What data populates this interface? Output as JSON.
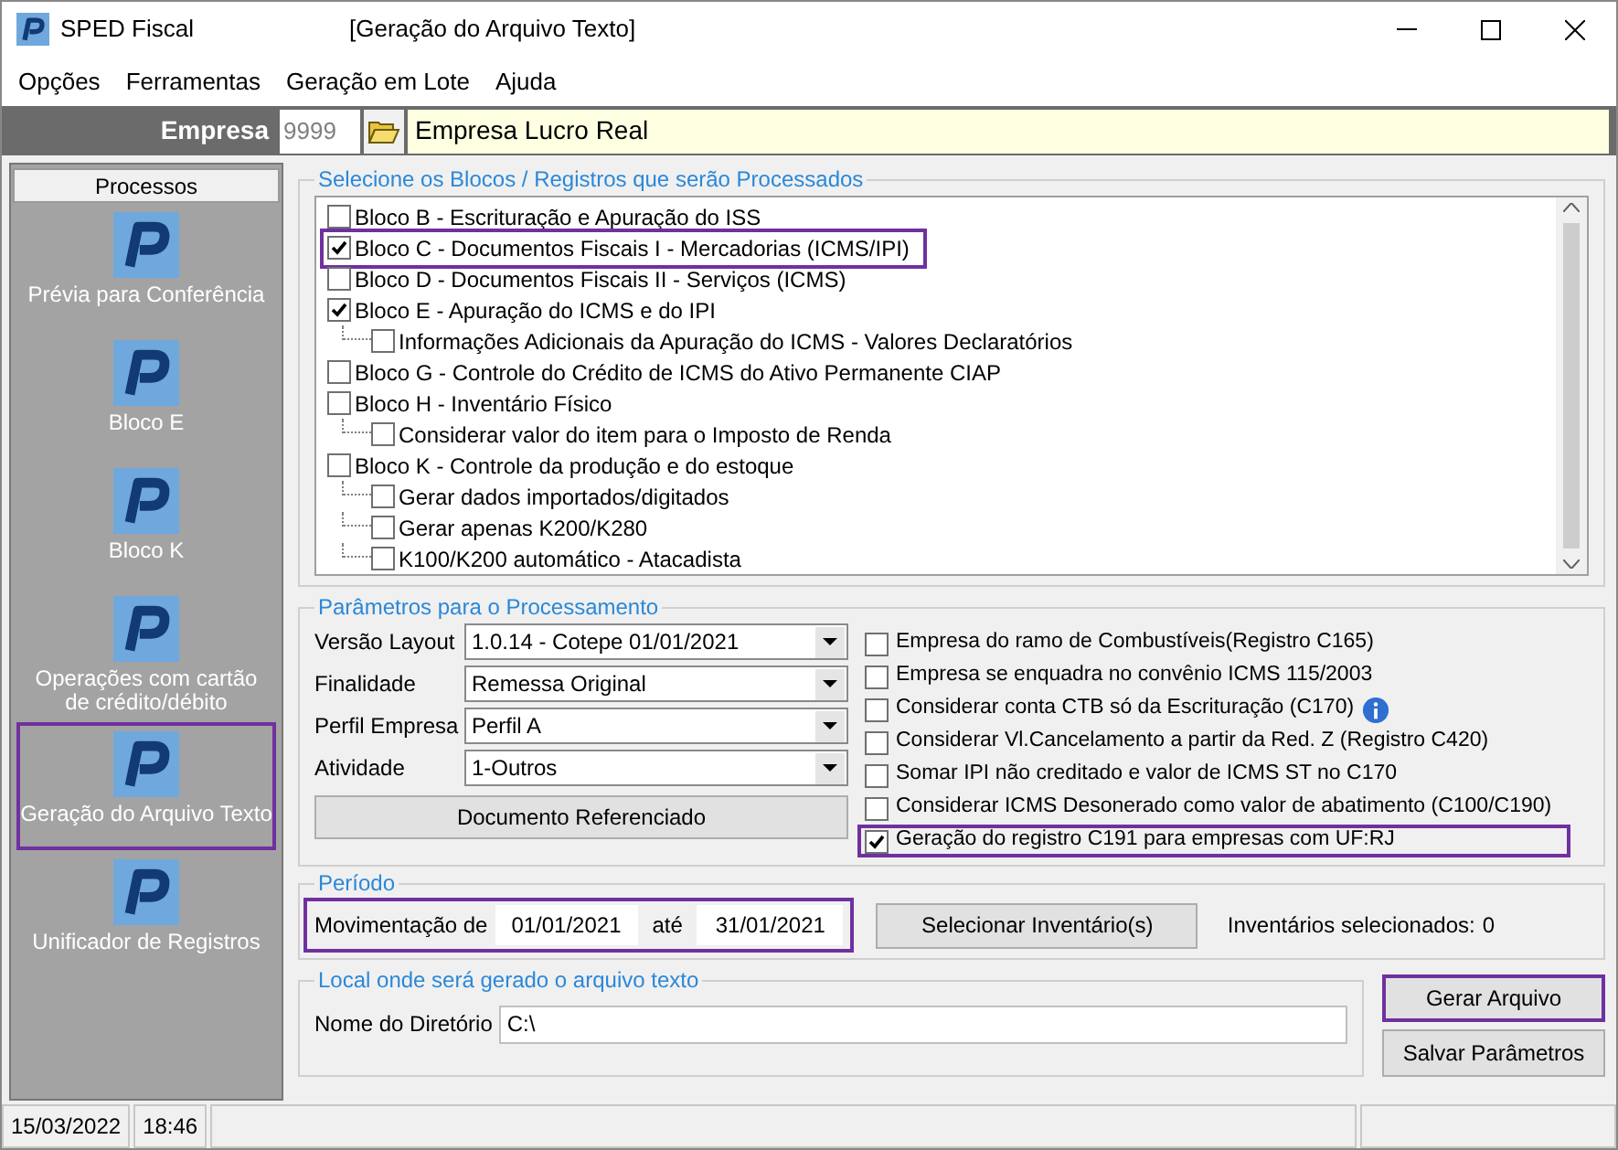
{
  "window": {
    "title": "SPED Fiscal",
    "subtitle": "[Geração do Arquivo Texto]"
  },
  "menu": [
    "Opções",
    "Ferramentas",
    "Geração em Lote",
    "Ajuda"
  ],
  "empresa": {
    "label": "Empresa",
    "code": "9999",
    "name": "Empresa Lucro Real"
  },
  "sidebar": {
    "title": "Processos",
    "items": [
      {
        "label": "Prévia para Conferência",
        "highlighted": false
      },
      {
        "label": "Bloco E",
        "highlighted": false
      },
      {
        "label": "Bloco K",
        "highlighted": false
      },
      {
        "label": "Operações com cartão de crédito/débito",
        "highlighted": false
      },
      {
        "label": "Geração do Arquivo Texto",
        "highlighted": true
      },
      {
        "label": "Unificador de Registros",
        "highlighted": false
      }
    ]
  },
  "blocks": {
    "title": "Selecione os Blocos / Registros que serão Processados",
    "items": [
      {
        "label": "Bloco B - Escrituração e Apuração do ISS",
        "checked": false,
        "highlighted": false
      },
      {
        "label": "Bloco C - Documentos Fiscais I - Mercadorias (ICMS/IPI)",
        "checked": true,
        "highlighted": true
      },
      {
        "label": "Bloco D - Documentos Fiscais II - Serviços (ICMS)",
        "checked": false,
        "highlighted": false
      },
      {
        "label": "Bloco E - Apuração do ICMS e do IPI",
        "checked": true,
        "highlighted": false,
        "children": [
          {
            "label": "Informações Adicionais da Apuração do ICMS - Valores Declaratórios",
            "checked": false,
            "highlighted": false
          }
        ]
      },
      {
        "label": "Bloco G - Controle do Crédito de ICMS do Ativo Permanente CIAP",
        "checked": false,
        "highlighted": false
      },
      {
        "label": "Bloco H - Inventário Físico",
        "checked": false,
        "highlighted": false,
        "children": [
          {
            "label": "Considerar valor do item para o Imposto de Renda",
            "checked": false,
            "highlighted": false
          }
        ]
      },
      {
        "label": "Bloco K - Controle da produção e do estoque",
        "checked": false,
        "highlighted": false,
        "children": [
          {
            "label": "Gerar dados importados/digitados",
            "checked": false,
            "highlighted": false
          },
          {
            "label": "Gerar apenas K200/K280",
            "checked": false,
            "highlighted": false
          },
          {
            "label": "K100/K200 automático - Atacadista",
            "checked": false,
            "highlighted": false
          }
        ]
      }
    ]
  },
  "parameters": {
    "title": "Parâmetros para o Processamento",
    "fields": [
      {
        "label": "Versão Layout",
        "value": "1.0.14 - Cotepe 01/01/2021"
      },
      {
        "label": "Finalidade",
        "value": "Remessa Original"
      },
      {
        "label": "Perfil Empresa",
        "value": "Perfil A"
      },
      {
        "label": "Atividade",
        "value": "1-Outros"
      }
    ],
    "button": "Documento Referenciado",
    "options": [
      {
        "label": "Empresa do ramo de Combustíveis(Registro C165)",
        "checked": false,
        "highlighted": false,
        "info": false
      },
      {
        "label": "Empresa se enquadra no convênio ICMS 115/2003",
        "checked": false,
        "highlighted": false,
        "info": false
      },
      {
        "label": "Considerar conta CTB só da Escrituração (C170)",
        "checked": false,
        "highlighted": false,
        "info": true
      },
      {
        "label": "Considerar Vl.Cancelamento a partir da Red. Z (Registro C420)",
        "checked": false,
        "highlighted": false,
        "info": false
      },
      {
        "label": "Somar IPI não creditado e valor de ICMS ST no C170",
        "checked": false,
        "highlighted": false,
        "info": false
      },
      {
        "label": "Considerar ICMS Desonerado como valor de abatimento (C100/C190)",
        "checked": false,
        "highlighted": false,
        "info": false
      },
      {
        "label": "Geração do registro C191 para empresas com UF:RJ",
        "checked": true,
        "highlighted": true,
        "info": false
      }
    ]
  },
  "period": {
    "title": "Período",
    "highlighted": true,
    "from_label": "Movimentação de",
    "from": "01/01/2021",
    "to_label": "até",
    "to": "31/01/2021",
    "button": "Selecionar Inventário(s)",
    "count_label": "Inventários selecionados:",
    "count": "0"
  },
  "output": {
    "title": "Local onde será gerado o arquivo texto",
    "label": "Nome do Diretório",
    "value": "C:\\"
  },
  "actions": [
    {
      "label": "Gerar Arquivo",
      "highlighted": true
    },
    {
      "label": "Salvar Parâmetros",
      "highlighted": false
    }
  ],
  "status_bar": [
    "15/03/2022",
    "18:46"
  ]
}
